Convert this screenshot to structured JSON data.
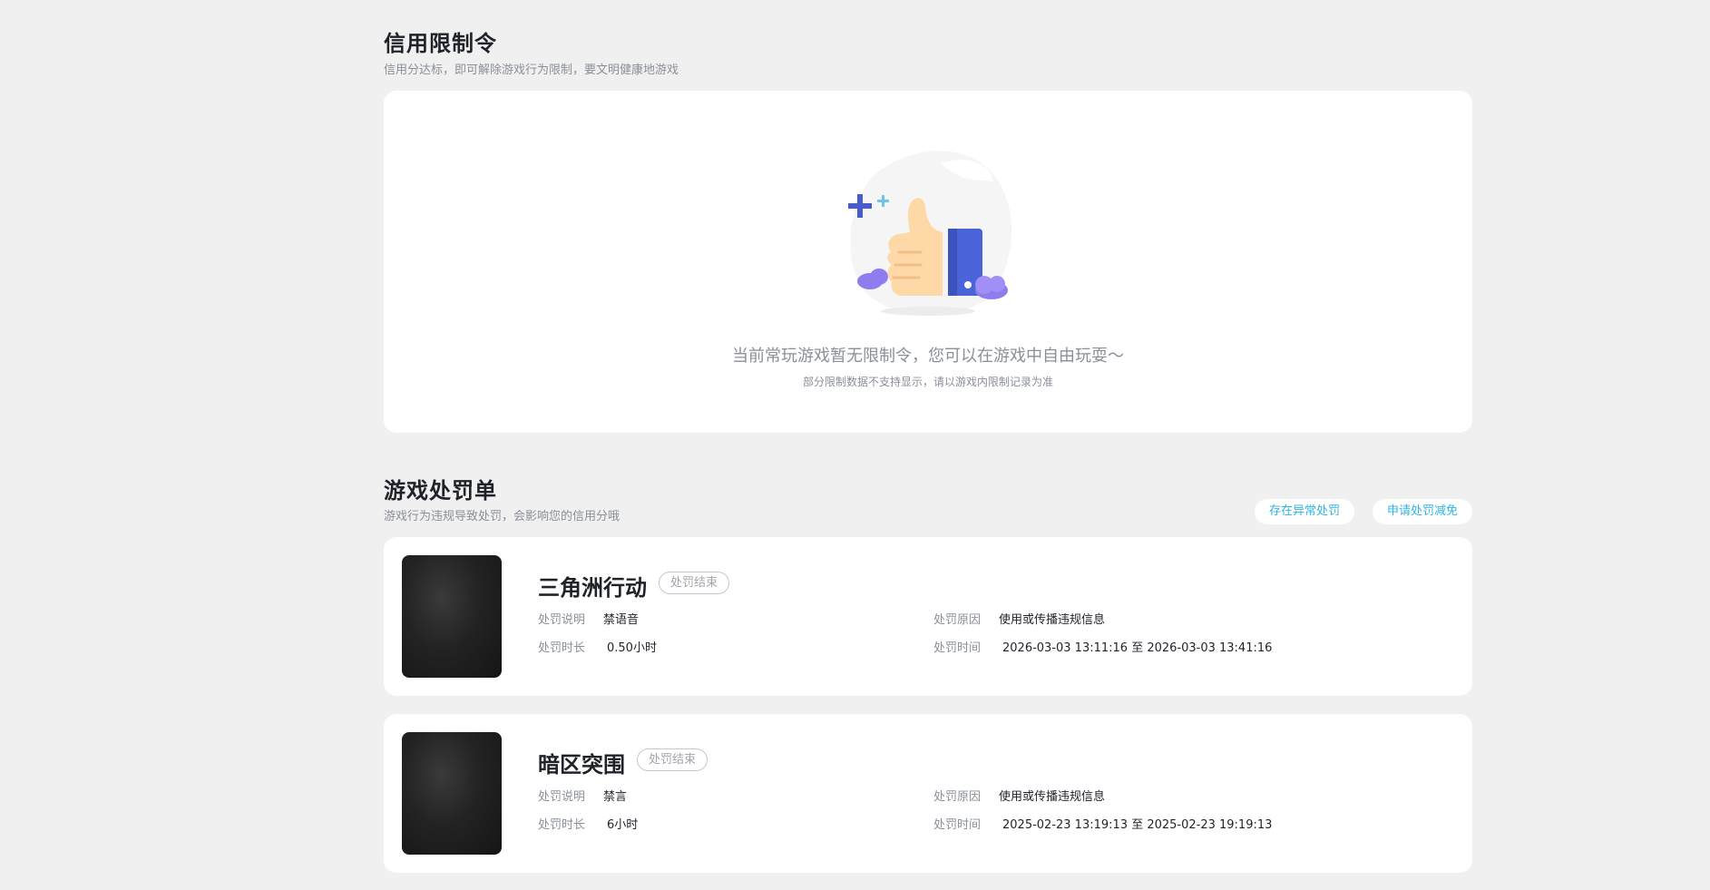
{
  "credit": {
    "title": "信用限制令",
    "subtitle": "信用分达标，即可解除游戏行为限制，要文明健康地游戏",
    "empty_main": "当前常玩游戏暂无限制令，您可以在游戏中自由玩耍～",
    "empty_sub": "部分限制数据不支持显示，请以游戏内限制记录为准"
  },
  "punish": {
    "title": "游戏处罚单",
    "subtitle": "游戏行为违规导致处罚，会影响您的信用分哦",
    "btn_abnormal": "存在异常处罚",
    "btn_appeal": "申请处罚减免",
    "labels": {
      "desc": "处罚说明",
      "duration": "处罚时长",
      "reason": "处罚原因",
      "time": "处罚时间"
    },
    "items": [
      {
        "game": "三角洲行动",
        "status": "处罚结束",
        "desc": "禁语音",
        "duration": "0.50小时",
        "reason": "使用或传播违规信息",
        "time": "2026-03-03 13:11:16 至 2026-03-03 13:41:16"
      },
      {
        "game": "暗区突围",
        "status": "处罚结束",
        "desc": "禁言",
        "duration": "6小时",
        "reason": "使用或传播违规信息",
        "time": "2025-02-23 13:19:13 至 2025-02-23 19:19:13"
      }
    ]
  },
  "colors": {
    "accent": "#2eb5e5",
    "page_bg": "#f0f0f0",
    "card_bg": "#ffffff",
    "thumb_blue": "#4a63d8"
  },
  "icons": {
    "illustration": "thumbs-up-illustration"
  }
}
